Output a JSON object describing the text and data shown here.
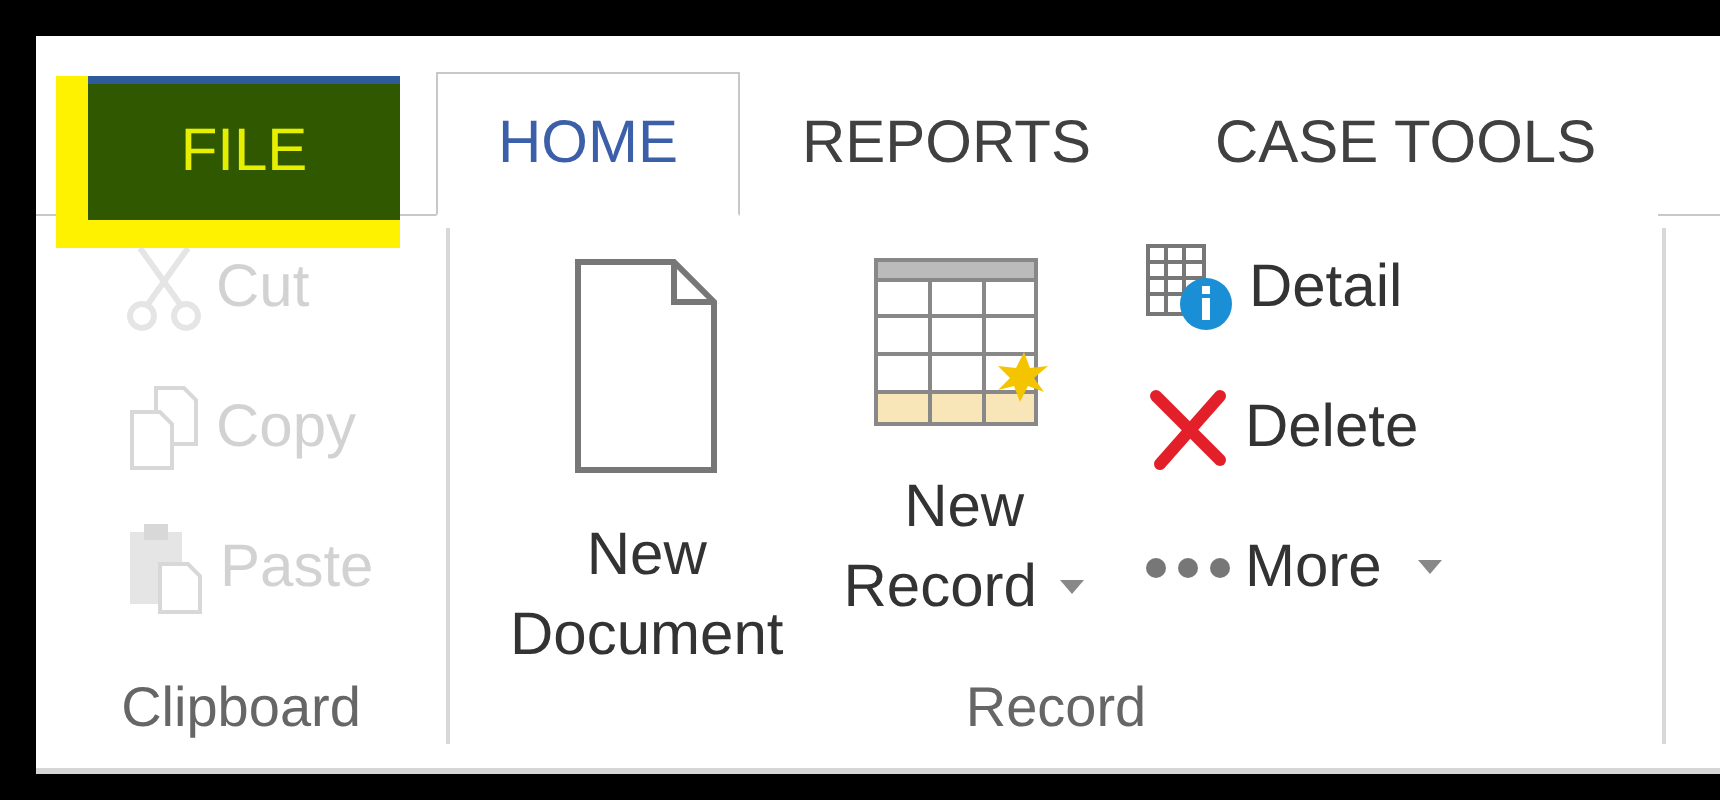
{
  "tabs": [
    {
      "label": "FILE",
      "kind": "file",
      "selected": false
    },
    {
      "label": "HOME",
      "kind": "tab",
      "selected": true
    },
    {
      "label": "REPORTS",
      "kind": "tab",
      "selected": false
    },
    {
      "label": "CASE TOOLS",
      "kind": "tab",
      "selected": false
    }
  ],
  "groups": [
    {
      "label": "Clipboard",
      "kind": "small",
      "items": [
        {
          "label": "Cut",
          "disabled": true,
          "dropdown": false
        },
        {
          "label": "Copy",
          "disabled": true,
          "dropdown": false
        },
        {
          "label": "Paste",
          "disabled": true,
          "dropdown": false
        }
      ]
    },
    {
      "label": "Record",
      "kind": "mixed",
      "large": [
        {
          "lines": [
            "New",
            "Document"
          ],
          "dropdown": false
        },
        {
          "lines": [
            "New",
            "Record"
          ],
          "dropdown": true
        }
      ],
      "items": [
        {
          "label": "Detail",
          "disabled": false,
          "dropdown": false
        },
        {
          "label": "Delete",
          "disabled": false,
          "dropdown": false
        },
        {
          "label": "More",
          "disabled": false,
          "dropdown": true
        }
      ]
    }
  ]
}
